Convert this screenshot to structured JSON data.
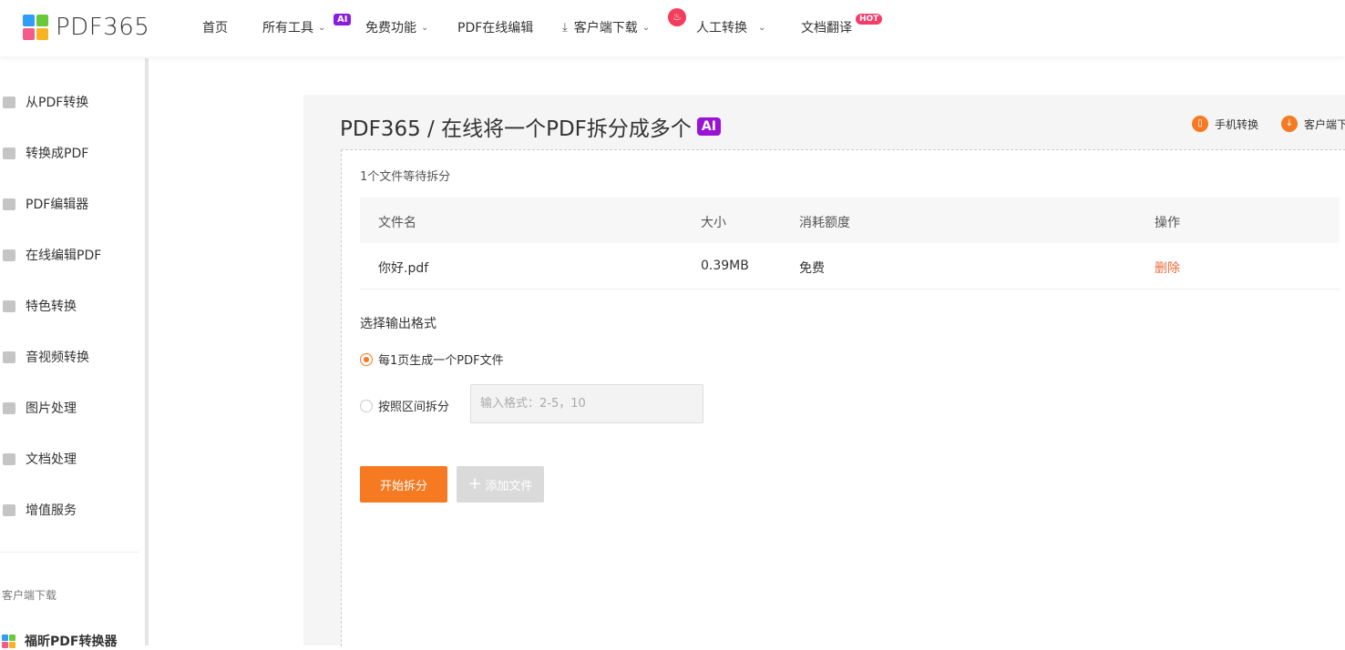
{
  "brand": {
    "logo_text": "PDF365"
  },
  "nav": {
    "home": "首页",
    "all_tools": "所有工具",
    "all_tools_badge": "AI",
    "free_features": "免费功能",
    "online_edit": "PDF在线编辑",
    "client_download": "客户端下载",
    "manual_convert": "人工转换",
    "doc_translate": "文档翻译",
    "doc_translate_badge": "HOT"
  },
  "sidebar": {
    "items": [
      {
        "label": "从PDF转换",
        "icon": "pdf-export-icon"
      },
      {
        "label": "转换成PDF",
        "icon": "pdf-import-icon"
      },
      {
        "label": "PDF编辑器",
        "icon": "pen-icon"
      },
      {
        "label": "在线编辑PDF",
        "icon": "online-edit-icon"
      },
      {
        "label": "特色转换",
        "icon": "star-icon"
      },
      {
        "label": "音视频转换",
        "icon": "media-icon"
      },
      {
        "label": "图片处理",
        "icon": "image-icon"
      },
      {
        "label": "文档处理",
        "icon": "document-icon"
      },
      {
        "label": "增值服务",
        "icon": "list-icon"
      }
    ],
    "section_label": "客户端下载",
    "app_label": "福昕PDF转换器"
  },
  "page": {
    "title": "PDF365 / 在线将一个PDF拆分成多个",
    "title_badge": "AI",
    "mobile_convert": "手机转换",
    "client_download": "客户端下"
  },
  "files": {
    "waiting_text": "1个文件等待拆分",
    "columns": {
      "name": "文件名",
      "size": "大小",
      "quota": "消耗额度",
      "action": "操作"
    },
    "rows": [
      {
        "name": "你好.pdf",
        "size": "0.39MB",
        "quota": "免费",
        "action": "删除"
      }
    ]
  },
  "output": {
    "title": "选择输出格式",
    "option_per_page": "每1页生成一个PDF文件",
    "option_per_page_checked": true,
    "option_range": "按照区间拆分",
    "range_placeholder": "输入格式：2-5，10"
  },
  "actions": {
    "start": "开始拆分",
    "add_file": "添加文件"
  },
  "colors": {
    "accent": "#f57a22",
    "ai_badge": "#9a12d6",
    "hot_badge": "#f43b6a",
    "delete": "#f06a3b"
  }
}
